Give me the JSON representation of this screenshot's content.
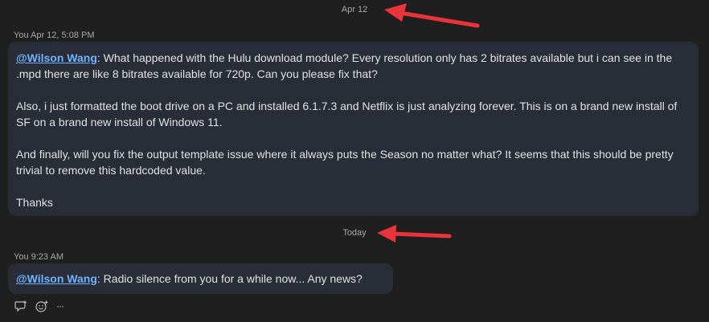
{
  "dividers": {
    "first": "Apr 12",
    "second": "Today"
  },
  "messages": [
    {
      "meta": "You Apr 12, 5:08 PM",
      "mention": "@Wilson Wang",
      "paragraphs": [
        ": What happened with the Hulu download module? Every resolution only has 2 bitrates available but i can see in the .mpd there are like 8 bitrates available for 720p. Can you please fix that?",
        "Also, i just formatted the boot drive on a PC and installed 6.1.7.3 and Netflix is just analyzing forever. This is on a brand new install of SF on a brand new install of Windows 11.",
        "And finally, will you fix the output template issue where it always puts the Season no matter what? It seems that this should be pretty trivial to remove this hardcoded value.",
        "Thanks"
      ]
    },
    {
      "meta": "You 9:23 AM",
      "mention": "@Wilson Wang",
      "paragraphs": [
        ": Radio silence from you for a while now... Any news?"
      ]
    }
  ],
  "actions": {
    "more_label": "···"
  },
  "colors": {
    "background": "#1f1f1f",
    "bubble": "#292d37",
    "mention": "#6fb2ff",
    "arrow": "#e8343a"
  }
}
